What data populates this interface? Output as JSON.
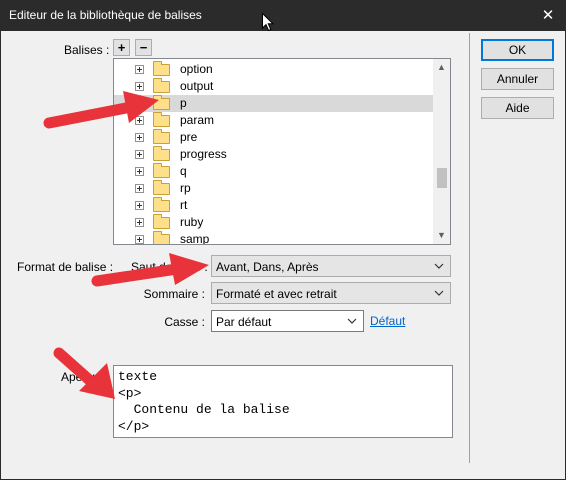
{
  "window": {
    "title": "Editeur de la bibliothèque de balises",
    "close_glyph": "✕"
  },
  "balises": {
    "label": "Balises :",
    "add_glyph": "+",
    "remove_glyph": "−",
    "items": [
      {
        "label": "option",
        "selected": false
      },
      {
        "label": "output",
        "selected": false
      },
      {
        "label": "p",
        "selected": true
      },
      {
        "label": "param",
        "selected": false
      },
      {
        "label": "pre",
        "selected": false
      },
      {
        "label": "progress",
        "selected": false
      },
      {
        "label": "q",
        "selected": false
      },
      {
        "label": "rp",
        "selected": false
      },
      {
        "label": "rt",
        "selected": false
      },
      {
        "label": "ruby",
        "selected": false
      },
      {
        "label": "samp",
        "selected": false
      }
    ]
  },
  "format": {
    "section_label": "Format de balise :",
    "saut_label": "Saut de ligne :",
    "saut_value": "Avant, Dans, Après",
    "sommaire_label": "Sommaire :",
    "sommaire_value": "Formaté et avec retrait",
    "casse_label": "Casse :",
    "casse_value": "Par défaut",
    "defaut_link": "Défaut"
  },
  "preview": {
    "label": "Aperçu :",
    "lines": [
      "texte",
      "<p>",
      "  Contenu de la balise",
      "</p>"
    ]
  },
  "buttons": {
    "ok": "OK",
    "annuler": "Annuler",
    "aide": "Aide"
  },
  "colors": {
    "titlebar": "#2b2b2b",
    "dialog_bg": "#f0f0f0",
    "selected_row": "#d9d9d9",
    "accent": "#0078d7",
    "link": "#0066cc",
    "arrow": "#e8333a"
  }
}
